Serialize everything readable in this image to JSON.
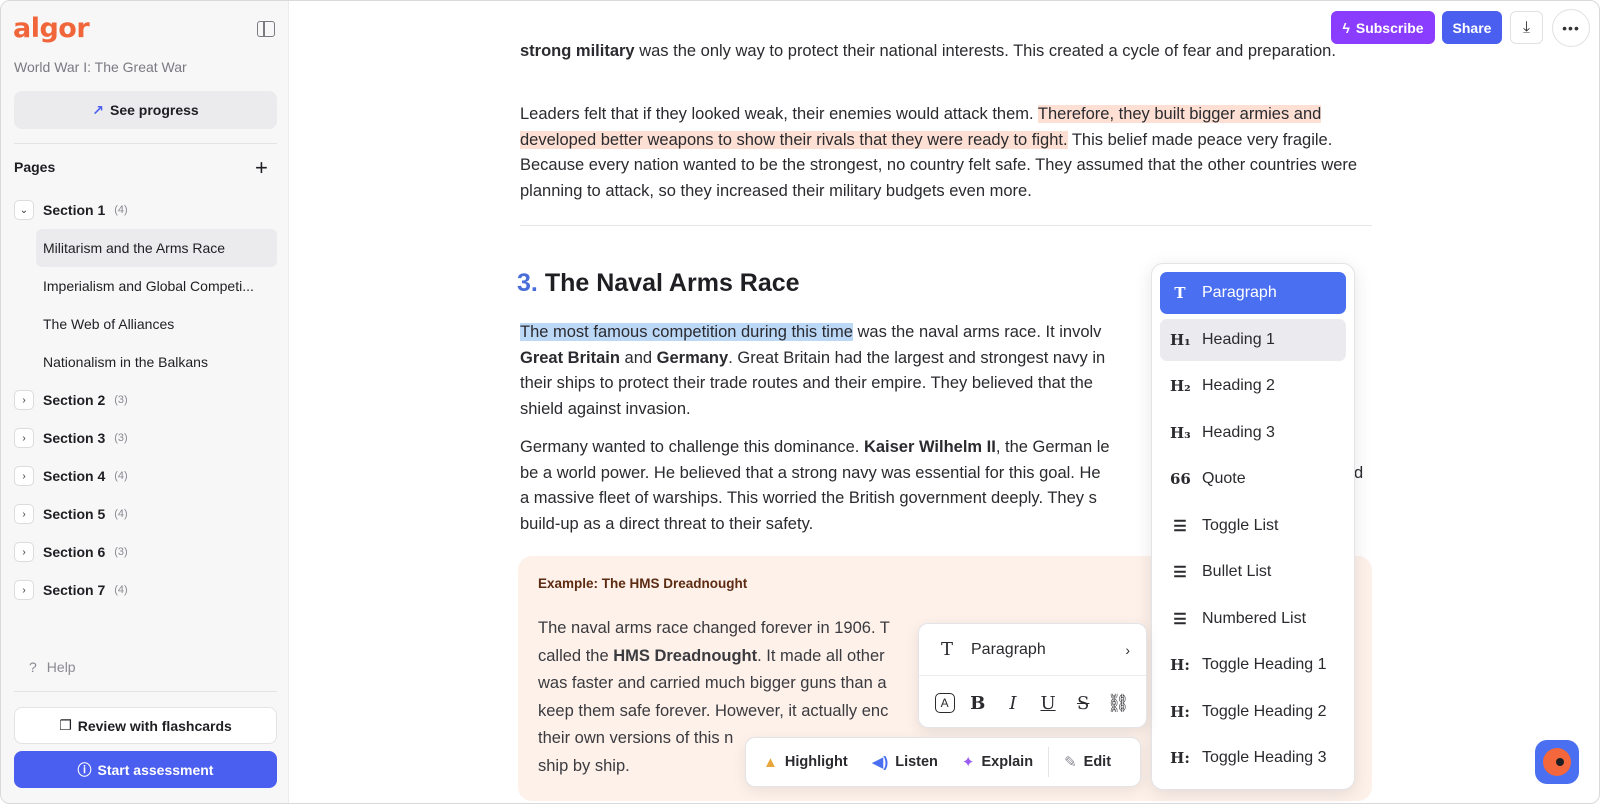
{
  "app": {
    "logo": "algor",
    "course_title": "World War I: The Great War",
    "see_progress": "See progress"
  },
  "sidebar": {
    "pages_label": "Pages",
    "sections": [
      {
        "name": "Section 1",
        "count": "(4)",
        "expanded": true,
        "pages": [
          "Militarism and the Arms Race",
          "Imperialism and Global Competi...",
          "The Web of Alliances",
          "Nationalism in the Balkans"
        ]
      },
      {
        "name": "Section 2",
        "count": "(3)"
      },
      {
        "name": "Section 3",
        "count": "(3)"
      },
      {
        "name": "Section 4",
        "count": "(4)"
      },
      {
        "name": "Section 5",
        "count": "(4)"
      },
      {
        "name": "Section 6",
        "count": "(3)"
      },
      {
        "name": "Section 7",
        "count": "(4)"
      }
    ],
    "help": "Help",
    "flashcards": "Review with flashcards",
    "assessment": "Start assessment"
  },
  "topbar": {
    "subscribe": "Subscribe",
    "share": "Share"
  },
  "content": {
    "p_top_bold": "strong military",
    "p_top_rest": " was the only way to protect their national interests. This created a cycle of fear and preparation.",
    "p_leaders_a": "Leaders felt that if they looked weak, their enemies would attack them. ",
    "p_leaders_hl": "Therefore, they built bigger armies and developed better weapons to show their rivals that they were ready to fight.",
    "p_leaders_b": " This belief made peace very fragile. Because every nation wanted to be the strongest, no country felt safe. They assumed that the other countries were planning to attack, so they increased their military budgets even more.",
    "heading_num": "3.",
    "heading_text": "The Naval Arms Race",
    "p_famous_hl": "The most famous competition during this time",
    "p_famous_a": " was the naval arms race. It involv",
    "p_famous_b1": "Great Britain",
    "p_famous_and": " and ",
    "p_famous_b2": "Germany",
    "p_famous_c": ". Great Britain had the largest and strongest navy in",
    "p_famous_d": "their ships to protect their trade routes and their empire. They believed that the",
    "p_famous_e": "shield against invasion.",
    "p_germany_a": "Germany wanted to challenge this dominance. ",
    "p_germany_b": "Kaiser Wilhelm II",
    "p_germany_c": ", the German le",
    "p_germany_d": "be a world power. He believed that a strong navy was essential for this goal. He",
    "p_germany_d_end": "d",
    "p_germany_e": "a massive fleet of warships. This worried the British government deeply. They s",
    "p_germany_f": "build-up as a direct threat to their safety.",
    "example_title": "Example: The HMS Dreadnought",
    "ex_l1": "The naval arms race changed forever in 1906. T",
    "ex_l2a": "called the ",
    "ex_l2b": "HMS Dreadnought",
    "ex_l2c": ". It made all other",
    "ex_l3": "was faster and carried much bigger guns than a",
    "ex_l4": "keep them safe forever. However, it actually enc",
    "ex_l5": "their own versions of this n",
    "ex_l6": "ship by ship."
  },
  "block_menu": {
    "items": [
      {
        "icon": "T",
        "label": "Paragraph",
        "state": "selected"
      },
      {
        "icon": "H₁",
        "label": "Heading 1",
        "state": "hover"
      },
      {
        "icon": "H₂",
        "label": "Heading 2"
      },
      {
        "icon": "H₃",
        "label": "Heading 3"
      },
      {
        "icon": "66",
        "label": "Quote"
      },
      {
        "icon": "☰",
        "label": "Toggle List"
      },
      {
        "icon": "☰",
        "label": "Bullet List"
      },
      {
        "icon": "☰",
        "label": "Numbered List"
      },
      {
        "icon": "H:",
        "label": "Toggle Heading 1"
      },
      {
        "icon": "H:",
        "label": "Toggle Heading 2"
      },
      {
        "icon": "H:",
        "label": "Toggle Heading 3"
      }
    ]
  },
  "format_bar": {
    "block_type": "Paragraph"
  },
  "action_bar": {
    "highlight": "Highlight",
    "listen": "Listen",
    "explain": "Explain",
    "edit": "Edit"
  },
  "colors": {
    "accent": "#4a5ff0",
    "subscribe": "#8b3dff",
    "logo": "#f0653a",
    "highlight_orange": "#fde0d3",
    "highlight_blue": "#bcd8f7",
    "example_bg": "#fdf1ea"
  }
}
